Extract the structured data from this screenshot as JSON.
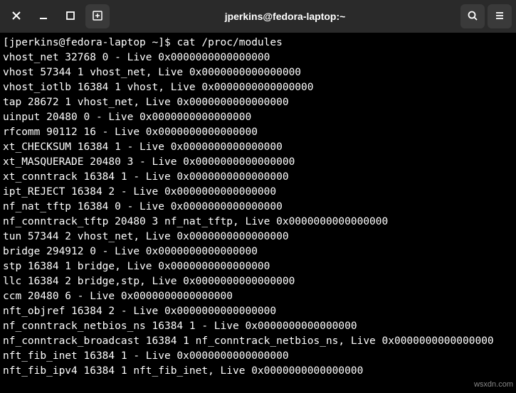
{
  "titlebar": {
    "title": "jperkins@fedora-laptop:~"
  },
  "terminal": {
    "prompt": "[jperkins@fedora-laptop ~]$ ",
    "command": "cat /proc/modules",
    "output": [
      "vhost_net 32768 0 - Live 0x0000000000000000",
      "vhost 57344 1 vhost_net, Live 0x0000000000000000",
      "vhost_iotlb 16384 1 vhost, Live 0x0000000000000000",
      "tap 28672 1 vhost_net, Live 0x0000000000000000",
      "uinput 20480 0 - Live 0x0000000000000000",
      "rfcomm 90112 16 - Live 0x0000000000000000",
      "xt_CHECKSUM 16384 1 - Live 0x0000000000000000",
      "xt_MASQUERADE 20480 3 - Live 0x0000000000000000",
      "xt_conntrack 16384 1 - Live 0x0000000000000000",
      "ipt_REJECT 16384 2 - Live 0x0000000000000000",
      "nf_nat_tftp 16384 0 - Live 0x0000000000000000",
      "nf_conntrack_tftp 20480 3 nf_nat_tftp, Live 0x0000000000000000",
      "tun 57344 2 vhost_net, Live 0x0000000000000000",
      "bridge 294912 0 - Live 0x0000000000000000",
      "stp 16384 1 bridge, Live 0x0000000000000000",
      "llc 16384 2 bridge,stp, Live 0x0000000000000000",
      "ccm 20480 6 - Live 0x0000000000000000",
      "nft_objref 16384 2 - Live 0x0000000000000000",
      "nf_conntrack_netbios_ns 16384 1 - Live 0x0000000000000000",
      "nf_conntrack_broadcast 16384 1 nf_conntrack_netbios_ns, Live 0x0000000000000000",
      "nft_fib_inet 16384 1 - Live 0x0000000000000000",
      "nft_fib_ipv4 16384 1 nft_fib_inet, Live 0x0000000000000000"
    ]
  },
  "watermark": "wsxdn.com"
}
